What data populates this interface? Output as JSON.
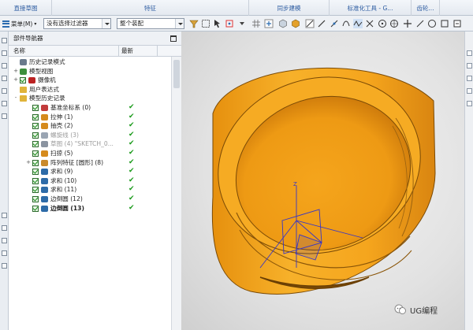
{
  "ribbon": {
    "groups": [
      "直接草图",
      "特征",
      "同步建模",
      "标准化工具 - G...",
      "齿轮..."
    ]
  },
  "selection_bar": {
    "menu_label": "菜单(M)",
    "filter_value": "没有选择过滤器",
    "scope_value": "整个装配"
  },
  "navigator": {
    "title": "部件导航器",
    "columns": {
      "name": "名称",
      "latest": "最新"
    },
    "items": [
      {
        "label": "历史记录模式",
        "level": 0,
        "icon": "history-icon",
        "expand": "",
        "checked": false,
        "latest": false,
        "style": "normal"
      },
      {
        "label": "模型视图",
        "level": 0,
        "icon": "model-views-icon",
        "expand": "+",
        "checked": false,
        "latest": false,
        "style": "normal"
      },
      {
        "label": "摄像机",
        "level": 0,
        "icon": "camera-icon",
        "expand": "+",
        "checked": true,
        "latest": false,
        "style": "normal"
      },
      {
        "label": "用户表达式",
        "level": 0,
        "icon": "folder-icon",
        "expand": "",
        "checked": false,
        "latest": false,
        "style": "normal"
      },
      {
        "label": "模型历史记录",
        "level": 0,
        "icon": "folder-icon",
        "expand": "-",
        "checked": false,
        "latest": false,
        "style": "normal"
      },
      {
        "label": "基准坐标系 (0)",
        "level": 1,
        "icon": "datum-csys-icon",
        "expand": "",
        "checked": true,
        "latest": true,
        "style": "normal"
      },
      {
        "label": "拉伸 (1)",
        "level": 1,
        "icon": "extrude-icon",
        "expand": "",
        "checked": true,
        "latest": true,
        "style": "normal"
      },
      {
        "label": "抽壳 (2)",
        "level": 1,
        "icon": "shell-icon",
        "expand": "",
        "checked": true,
        "latest": true,
        "style": "normal"
      },
      {
        "label": "螺旋线 (3)",
        "level": 1,
        "icon": "helix-icon",
        "expand": "",
        "checked": true,
        "latest": true,
        "style": "dim"
      },
      {
        "label": "草图 (4) \"SKETCH_0...",
        "level": 1,
        "icon": "sketch-icon",
        "expand": "",
        "checked": true,
        "latest": true,
        "style": "dim"
      },
      {
        "label": "扫掠 (5)",
        "level": 1,
        "icon": "sweep-icon",
        "expand": "",
        "checked": true,
        "latest": true,
        "style": "normal"
      },
      {
        "label": "阵列特征 [圆形] (8)",
        "level": 1,
        "icon": "pattern-icon",
        "expand": "+",
        "checked": true,
        "latest": true,
        "style": "normal"
      },
      {
        "label": "求和 (9)",
        "level": 1,
        "icon": "unite-icon",
        "expand": "",
        "checked": true,
        "latest": true,
        "style": "normal"
      },
      {
        "label": "求和 (10)",
        "level": 1,
        "icon": "unite-icon",
        "expand": "",
        "checked": true,
        "latest": true,
        "style": "normal"
      },
      {
        "label": "求和 (11)",
        "level": 1,
        "icon": "unite-icon",
        "expand": "",
        "checked": true,
        "latest": true,
        "style": "normal"
      },
      {
        "label": "边倒圆 (12)",
        "level": 1,
        "icon": "edge-blend-icon",
        "expand": "",
        "checked": true,
        "latest": true,
        "style": "normal"
      },
      {
        "label": "边倒圆 (13)",
        "level": 1,
        "icon": "edge-blend-icon",
        "expand": "",
        "checked": true,
        "latest": true,
        "style": "bold"
      }
    ]
  },
  "watermark": {
    "text": "UG编程"
  },
  "colors": {
    "part": "#f4a41c",
    "part_shadow": "#c0700a",
    "accent": "#2b6cb0",
    "check": "#1a9a1a"
  }
}
